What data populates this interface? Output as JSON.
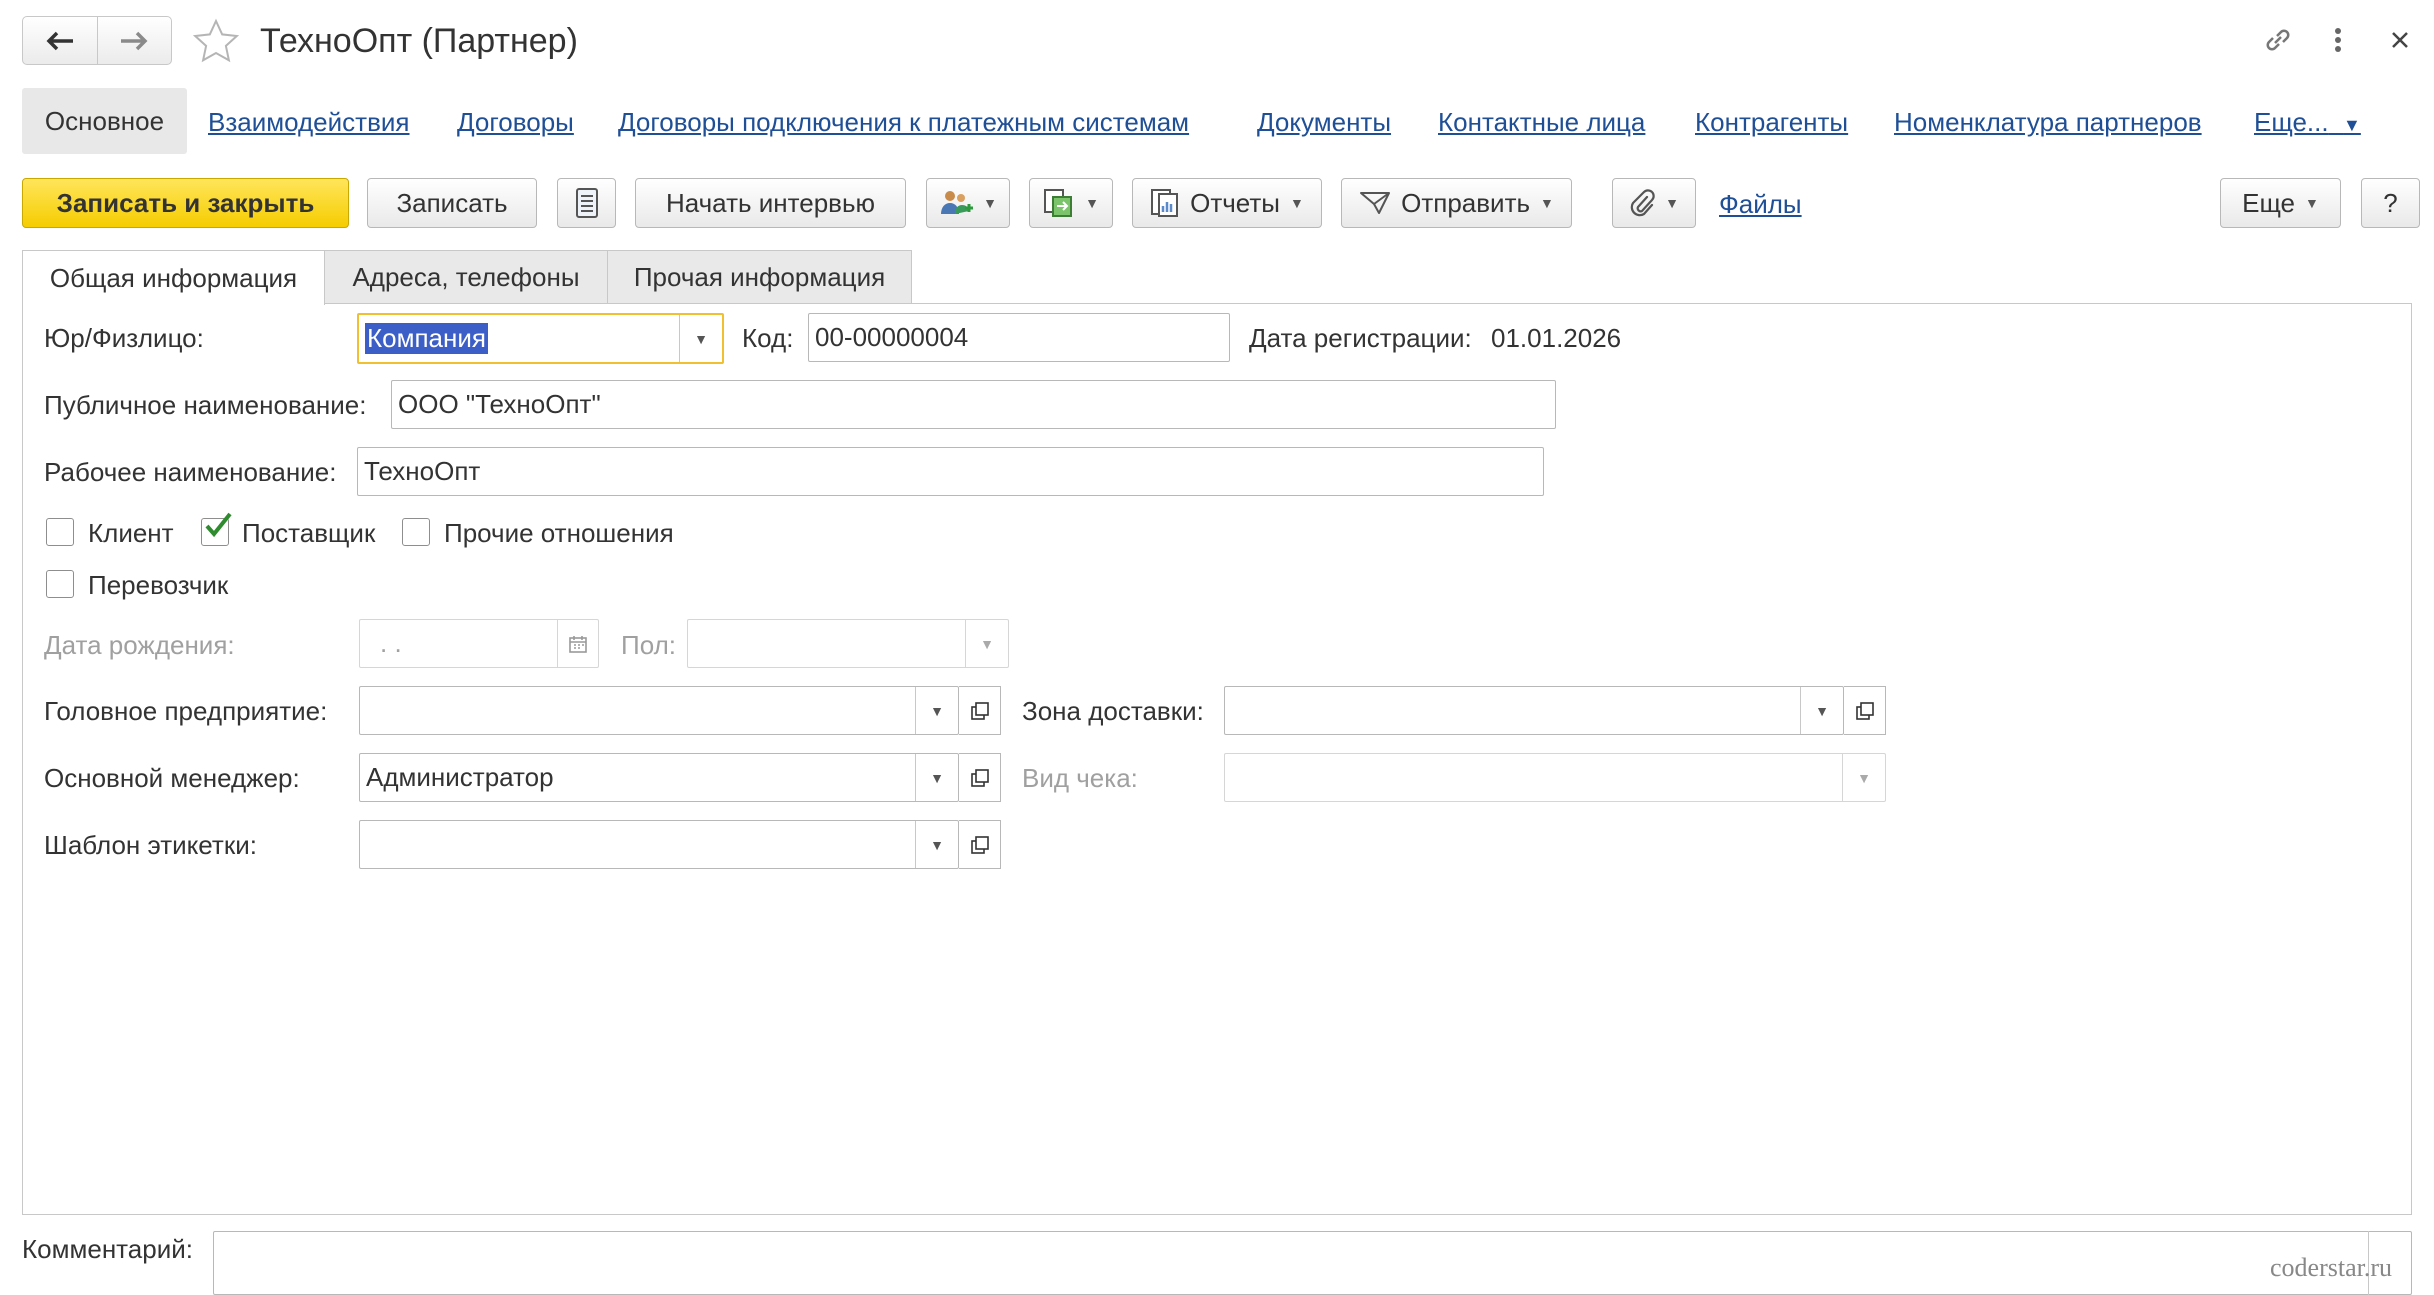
{
  "title_bar": {
    "title": "ТехноОпт (Партнер)",
    "icons": [
      "back-arrow-icon",
      "forward-arrow-icon",
      "star-icon",
      "link-icon",
      "kebab-menu-icon",
      "close-icon"
    ]
  },
  "sections": {
    "active": "Основное",
    "links": [
      "Взаимодействия",
      "Договоры",
      "Договоры подключения к платежным системам",
      "Документы",
      "Контактные лица",
      "Контрагенты",
      "Номенклатура партнеров"
    ],
    "more": "Еще..."
  },
  "toolbar": {
    "save_close": "Записать и закрыть",
    "save": "Записать",
    "start_interview": "Начать интервью",
    "reports": "Отчеты",
    "send": "Отправить",
    "files": "Файлы",
    "more": "Еще",
    "help": "?"
  },
  "tabs": [
    "Общая информация",
    "Адреса, телефоны",
    "Прочая информация"
  ],
  "form": {
    "legal_type": {
      "label": "Юр/Физлицо:",
      "value": "Компания"
    },
    "code": {
      "label": "Код:",
      "value": "00-00000004"
    },
    "reg_date": {
      "label": "Дата регистрации:",
      "value": "01.01.2026"
    },
    "public_name": {
      "label": "Публичное наименование:",
      "value": "ООО \"ТехноОпт\""
    },
    "work_name": {
      "label": "Рабочее наименование:",
      "value": "ТехноОпт"
    },
    "checkboxes": [
      {
        "label": "Клиент",
        "checked": false
      },
      {
        "label": "Поставщик",
        "checked": true
      },
      {
        "label": "Прочие отношения",
        "checked": false
      },
      {
        "label": "Перевозчик",
        "checked": false
      }
    ],
    "birth_date": {
      "label": "Дата рождения:",
      "value": " .  ."
    },
    "gender": {
      "label": "Пол:",
      "value": ""
    },
    "head_company": {
      "label": "Головное предприятие:",
      "value": ""
    },
    "delivery_zone": {
      "label": "Зона доставки:",
      "value": ""
    },
    "manager": {
      "label": "Основной менеджер:",
      "value": "Администратор"
    },
    "receipt_type": {
      "label": "Вид чека:",
      "value": ""
    },
    "label_template": {
      "label": "Шаблон этикетки:",
      "value": ""
    },
    "comment": {
      "label": "Комментарий:",
      "value": ""
    }
  },
  "watermark": "coderstar.ru"
}
